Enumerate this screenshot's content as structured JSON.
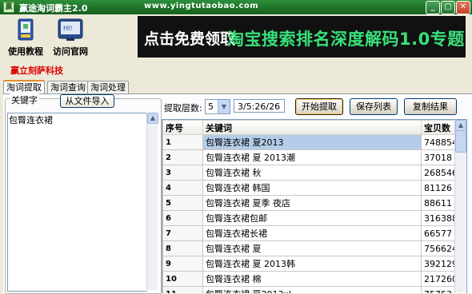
{
  "window": {
    "title": "赢途淘词霸主2.0",
    "url_text": "www.yingtutaobao.com",
    "controls": [
      "min",
      "max",
      "close"
    ]
  },
  "toolbar": {
    "tutorial_label": "使用教程",
    "website_label": "访问官网"
  },
  "banner": {
    "part1": "点击免费领取",
    "part2": "淘宝搜索排名深度解码1.0专题"
  },
  "company": "赢立刻萨科技",
  "tabs": [
    {
      "label": "淘词提取",
      "active": true
    },
    {
      "label": "淘词查询",
      "active": false
    },
    {
      "label": "淘词处理",
      "active": false
    }
  ],
  "keywords_panel": {
    "legend": "关键字",
    "import_button": "从文件导入",
    "value": "包臀连衣裙"
  },
  "controls": {
    "level_label": "提取层数:",
    "level_value": "5",
    "levels_text": "3/5:26/26",
    "start_button": "开始提取",
    "save_button": "保存列表",
    "copy_button": "复制结果"
  },
  "table": {
    "columns": [
      "序号",
      "关键词",
      "宝贝数"
    ],
    "rows": [
      {
        "idx": "1",
        "kw": "包臀连衣裙 夏2013",
        "count": "748854",
        "selected": true
      },
      {
        "idx": "2",
        "kw": "包臀连衣裙 夏 2013潮",
        "count": "37018"
      },
      {
        "idx": "3",
        "kw": "包臀连衣裙 秋",
        "count": "268546"
      },
      {
        "idx": "4",
        "kw": "包臀连衣裙 韩国",
        "count": "81126"
      },
      {
        "idx": "5",
        "kw": "包臀连衣裙 夏季 夜店",
        "count": "88611"
      },
      {
        "idx": "6",
        "kw": "包臀连衣裙包邮",
        "count": "316388"
      },
      {
        "idx": "7",
        "kw": "包臀连衣裙长裙",
        "count": "66577"
      },
      {
        "idx": "8",
        "kw": "包臀连衣裙 夏",
        "count": "756624"
      },
      {
        "idx": "9",
        "kw": "包臀连衣裙 夏 2013韩",
        "count": "392129"
      },
      {
        "idx": "10",
        "kw": "包臀连衣裙 棉",
        "count": "217260"
      },
      {
        "idx": "11",
        "kw": "包臀连衣裙 夏2013xl",
        "count": "75753"
      }
    ]
  },
  "colors": {
    "titlebar": "#1d6f27",
    "banner_bg": "#111111",
    "banner_green": "#39e07a",
    "company_red": "#dd0000",
    "selection": "#b4cce8"
  }
}
